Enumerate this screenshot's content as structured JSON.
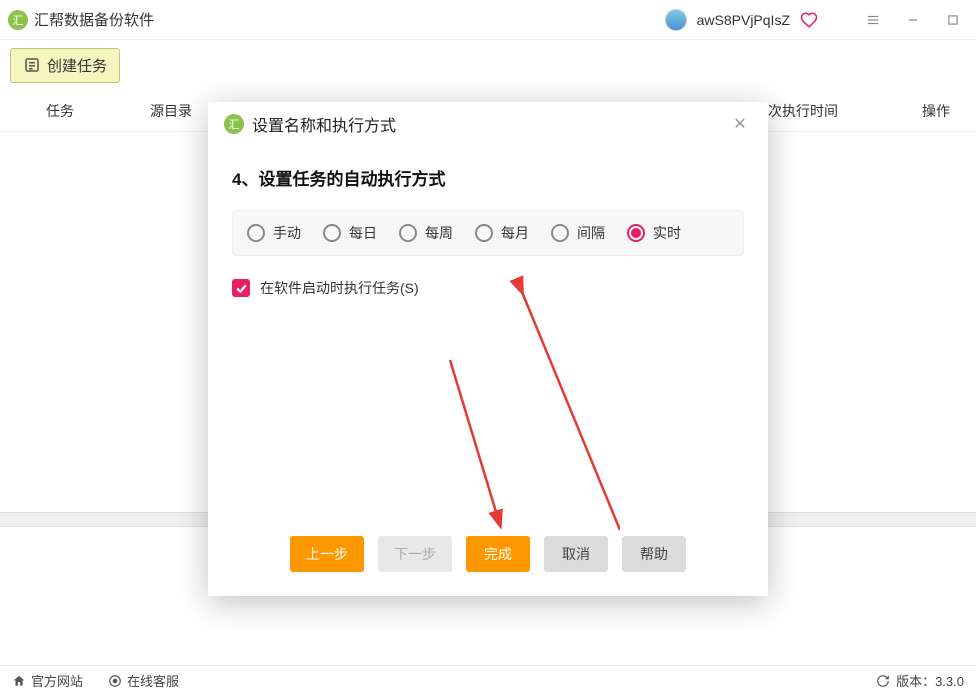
{
  "titlebar": {
    "app_name": "汇帮数据备份软件",
    "username": "awS8PVjPqIsZ"
  },
  "toolbar": {
    "create_btn": "创建任务"
  },
  "columns": {
    "task": "任务",
    "source": "源目录",
    "next_run": "下次执行时间",
    "ops": "操作"
  },
  "modal": {
    "title": "设置名称和执行方式",
    "heading": "4、设置任务的自动执行方式",
    "radios": {
      "manual": "手动",
      "daily": "每日",
      "weekly": "每周",
      "monthly": "每月",
      "interval": "间隔",
      "realtime": "实时"
    },
    "selected_radio": "realtime",
    "checkbox_label": "在软件启动时执行任务(S)",
    "checkbox_checked": true,
    "buttons": {
      "prev": "上一步",
      "next": "下一步",
      "finish": "完成",
      "cancel": "取消",
      "help": "帮助"
    }
  },
  "statusbar": {
    "official": "官方网站",
    "service": "在线客服",
    "version_label": "版本：3.3.0"
  }
}
